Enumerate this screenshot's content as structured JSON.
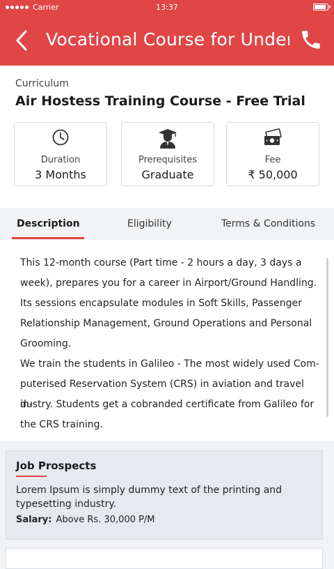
{
  "status": {
    "carrier": "Carrier",
    "time": "13:37"
  },
  "appbar": {
    "title": "Vocational Course for Under..",
    "back_icon": "back-chevron-icon",
    "call_icon": "phone-icon"
  },
  "header": {
    "label": "Curriculum",
    "course_title": "Air Hostess Training Course - Free Trial",
    "cards": [
      {
        "icon": "clock-icon",
        "label": "Duration",
        "value": "3 Months"
      },
      {
        "icon": "graduate-icon",
        "label": "Prerequisites",
        "value": "Graduate"
      },
      {
        "icon": "money-icon",
        "label": "Fee",
        "value": "₹ 50,000"
      }
    ]
  },
  "tabs": [
    "Description",
    "Eligibility",
    "Terms & Conditions"
  ],
  "active_tab": "Description",
  "description": {
    "lines": [
      "This 12-month course (Part time - 2 hours a day, 3 days a",
      "week), prepares you for a career in Airport/Ground Handling.",
      "Its sessions encapsulate modules in Soft Skills, Passenger",
      "Relationship Management, Ground Operations and Personal",
      "Grooming.",
      "We train the students in Galileo - The most widely used Com-",
      "puterised Reservation System (CRS) in aviation and travel in-",
      "dustry. Students get a cobranded certificate from Galileo for",
      "the CRS training."
    ]
  },
  "job": {
    "title": "Job Prospects",
    "text": "Lorem Ipsum is simply dummy text of the printing and typesetting industry.",
    "salary_label": "Salary:",
    "salary_value": "Above Rs. 30,000 P/M"
  },
  "colors": {
    "accent": "#e04646",
    "background": "#f2f3f5",
    "card_border": "#dcdcdc"
  }
}
